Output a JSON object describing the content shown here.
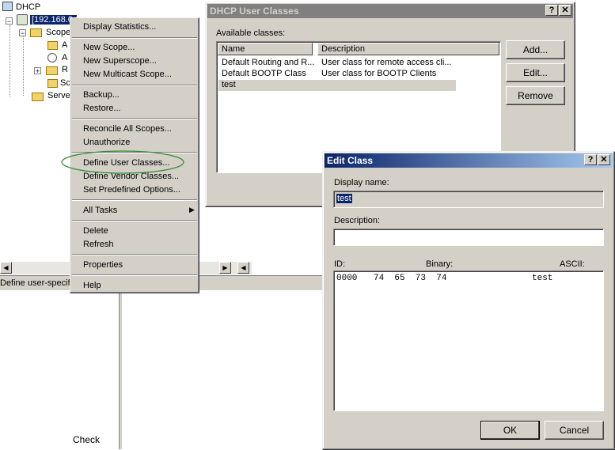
{
  "tree": {
    "root_label": "DHCP",
    "server_label": "[192.168.0.10]",
    "scope_label": "Scope",
    "child_a1": "A",
    "child_a2": "A",
    "child_r": "R",
    "child_s": "Sc",
    "server_options_label": "Serve"
  },
  "status_text": "Define user-specific",
  "bottom_text": "Check",
  "context_menu": {
    "items": [
      "Display Statistics...",
      "New Scope...",
      "New Superscope...",
      "New Multicast Scope...",
      "Backup...",
      "Restore...",
      "Reconcile All Scopes...",
      "Unauthorize",
      "Define User Classes...",
      "Define Vendor Classes...",
      "Set Predefined Options...",
      "All Tasks",
      "Delete",
      "Refresh",
      "Properties",
      "Help"
    ]
  },
  "user_classes_dialog": {
    "title": "DHCP User Classes",
    "available_label": "Available classes:",
    "columns": [
      "Name",
      "Description"
    ],
    "rows": [
      {
        "name": "Default Routing and R...",
        "description": "User class for remote access cli..."
      },
      {
        "name": "Default BOOTP Class",
        "description": "User class for BOOTP Clients"
      },
      {
        "name": "test",
        "description": ""
      }
    ],
    "buttons": {
      "add": "Add...",
      "edit": "Edit...",
      "remove": "Remove"
    },
    "help_btn": "?",
    "close_btn": "✕"
  },
  "edit_class_dialog": {
    "title": "Edit Class",
    "display_name_label": "Display name:",
    "display_name_value": "test",
    "description_label": "Description:",
    "description_value": "",
    "id_label": "ID:",
    "binary_label": "Binary:",
    "ascii_label": "ASCII:",
    "data_offset": "0000",
    "data_hex": "74  65  73  74",
    "data_ascii": "test",
    "ok": "OK",
    "cancel": "Cancel",
    "help_btn": "?",
    "close_btn": "✕"
  },
  "colors": {
    "face": "#d4d0c8",
    "active_title": "#0a246a",
    "inactive_title": "#808080",
    "selection": "#0a246a",
    "highlight_ellipse": "#2e8b2e"
  }
}
